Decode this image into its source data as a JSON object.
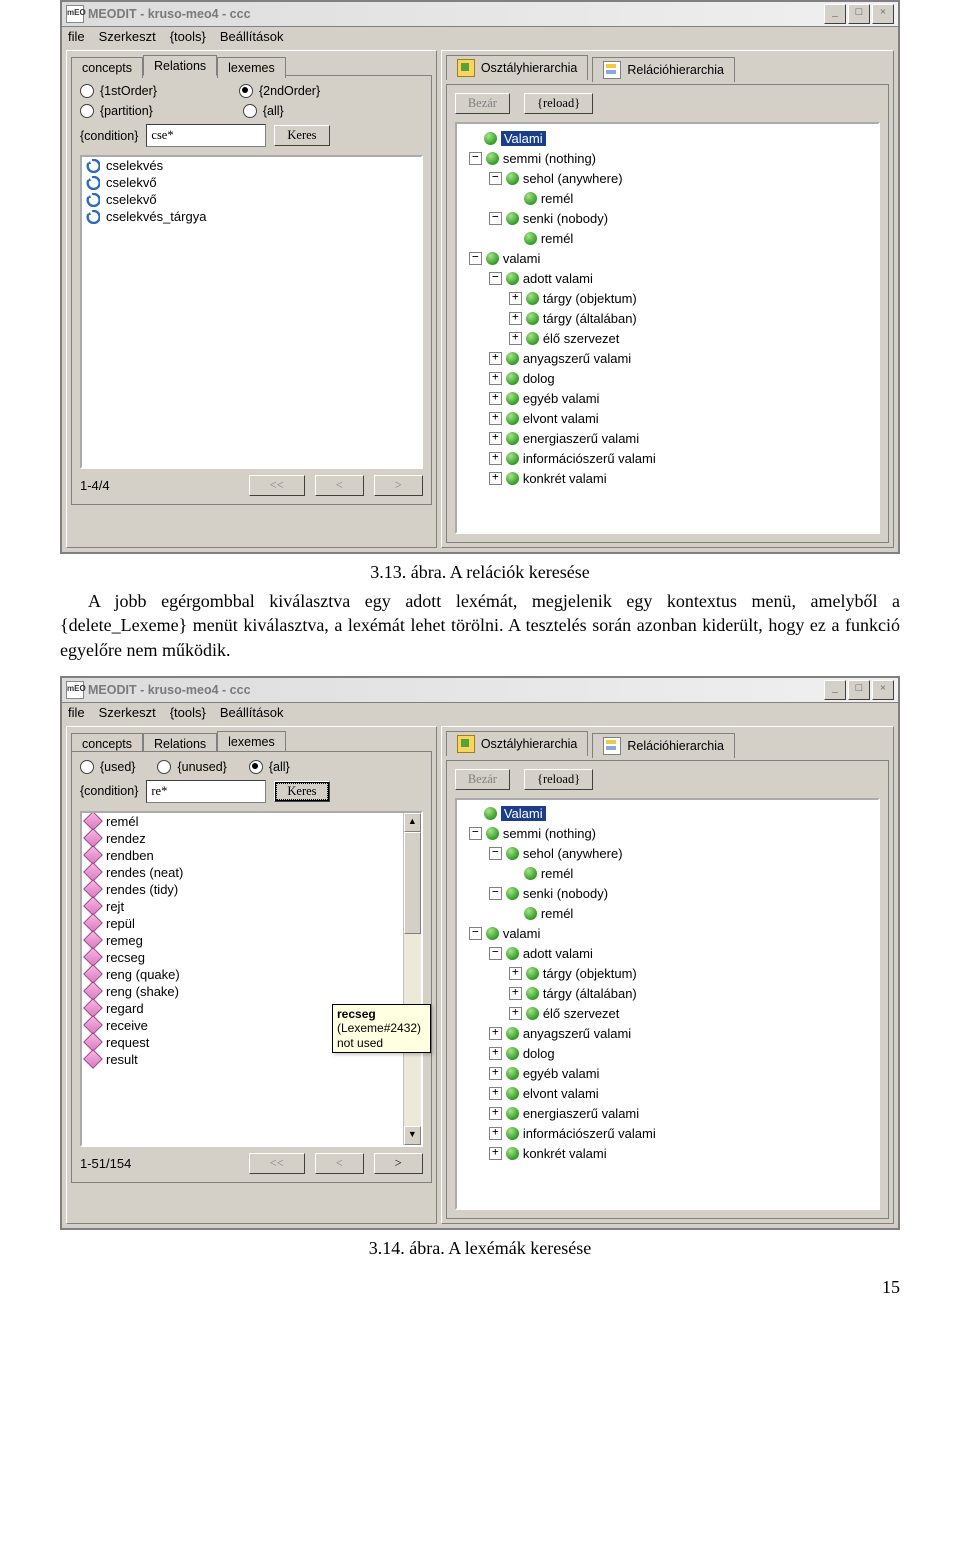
{
  "captions": {
    "fig13": "3.13. ábra. A relációk keresése",
    "fig14": "3.14. ábra. A lexémák keresése"
  },
  "paragraph": "A jobb egérgombbal kiválasztva egy adott lexémát, megjelenik egy kontextus menü, amelyből a {delete_Lexeme} menüt kiválasztva, a lexémát lehet törölni. A tesztelés során azonban kiderült, hogy ez a funkció egyelőre nem működik.",
  "page_number": "15",
  "app": {
    "icon_label": "mEO",
    "title": "MEODIT - kruso-meo4 - ccc",
    "win_buttons": {
      "min": "_",
      "max": "□",
      "close": "×"
    },
    "menus": [
      "file",
      "Szerkeszt",
      "{tools}",
      "Beállítások"
    ]
  },
  "shot1": {
    "left_tabs": [
      "concepts",
      "Relations",
      "lexemes"
    ],
    "left_active_tab": 1,
    "radios_row1": [
      {
        "label": "{1stOrder}",
        "checked": false
      },
      {
        "label": "{2ndOrder}",
        "checked": true
      }
    ],
    "radios_row2": [
      {
        "label": "{partition}",
        "checked": false
      },
      {
        "label": "{all}",
        "checked": false
      }
    ],
    "condition_label": "{condition}",
    "condition_value": "cse*",
    "search_button": "Keres",
    "list": [
      "cselekvés",
      "cselekvő",
      "cselekvő",
      "cselekvés_tárgya"
    ],
    "pager": {
      "status": "1-4/4",
      "prevAll": "<<",
      "prev": "<",
      "next": ">"
    },
    "right_tabs": [
      "Osztályhierarchia",
      "Relációhierarchia"
    ],
    "right_buttons": {
      "close": "Bezár",
      "reload": "{reload}"
    },
    "tree": [
      {
        "d": 0,
        "exp": "",
        "sel": true,
        "label": "Valami"
      },
      {
        "d": 0,
        "exp": "-",
        "label": "semmi (nothing)"
      },
      {
        "d": 1,
        "exp": "-",
        "label": "sehol (anywhere)"
      },
      {
        "d": 2,
        "exp": "",
        "label": "remél"
      },
      {
        "d": 1,
        "exp": "-",
        "label": "senki (nobody)"
      },
      {
        "d": 2,
        "exp": "",
        "label": "remél"
      },
      {
        "d": 0,
        "exp": "-",
        "label": "valami"
      },
      {
        "d": 1,
        "exp": "-",
        "label": "adott valami"
      },
      {
        "d": 2,
        "exp": "+",
        "label": "tárgy (objektum)"
      },
      {
        "d": 2,
        "exp": "+",
        "label": "tárgy (általában)"
      },
      {
        "d": 2,
        "exp": "+",
        "label": "élő szervezet"
      },
      {
        "d": 1,
        "exp": "+",
        "label": "anyagszerű valami"
      },
      {
        "d": 1,
        "exp": "+",
        "label": "dolog"
      },
      {
        "d": 1,
        "exp": "+",
        "label": "egyéb valami"
      },
      {
        "d": 1,
        "exp": "+",
        "label": "elvont valami"
      },
      {
        "d": 1,
        "exp": "+",
        "label": "energiaszerű valami"
      },
      {
        "d": 1,
        "exp": "+",
        "label": "információszerű valami"
      },
      {
        "d": 1,
        "exp": "+",
        "label": "konkrét valami"
      }
    ]
  },
  "shot2": {
    "left_tabs": [
      "concepts",
      "Relations",
      "lexemes"
    ],
    "left_active_tab": 2,
    "radios_row1": [
      {
        "label": "{used}",
        "checked": false
      },
      {
        "label": "{unused}",
        "checked": false
      },
      {
        "label": "{all}",
        "checked": true
      }
    ],
    "condition_label": "{condition}",
    "condition_value": "re*",
    "search_button": "Keres",
    "list": [
      "remél",
      "rendez",
      "rendben",
      "rendes (neat)",
      "rendes (tidy)",
      "rejt",
      "repül",
      "remeg",
      "recseg",
      "reng (quake)",
      "reng (shake)",
      "regard",
      "receive",
      "request",
      "result"
    ],
    "pager": {
      "status": "1-51/154",
      "prevAll": "<<",
      "prev": "<",
      "next": ">"
    },
    "tooltip_title": "recseg",
    "tooltip_meta": "(Lexeme#2432)",
    "tooltip_line2": "not used"
  }
}
